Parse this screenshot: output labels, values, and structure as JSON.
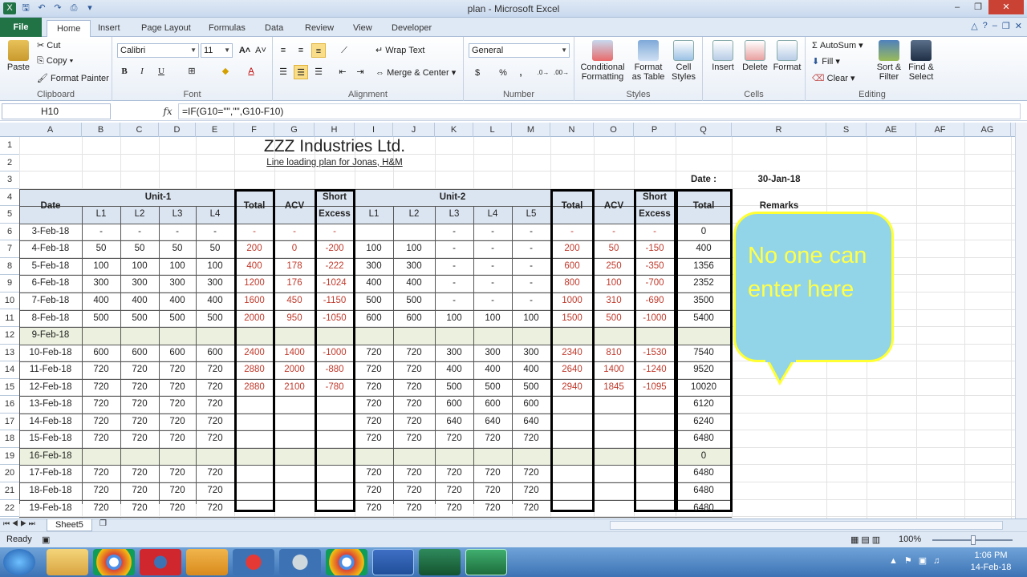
{
  "window": {
    "title": "plan  -  Microsoft Excel"
  },
  "tabs": [
    "File",
    "Home",
    "Insert",
    "Page Layout",
    "Formulas",
    "Data",
    "Review",
    "View",
    "Developer"
  ],
  "ribbon": {
    "clipboard": {
      "paste": "Paste",
      "cut": "Cut",
      "copy": "Copy",
      "format_painter": "Format Painter",
      "label": "Clipboard"
    },
    "font": {
      "name": "Calibri",
      "size": "11",
      "bold": "B",
      "italic": "I",
      "underline": "U",
      "label": "Font"
    },
    "alignment": {
      "wrap": "Wrap Text",
      "merge": "Merge & Center",
      "label": "Alignment"
    },
    "number": {
      "format": "General",
      "currency": "$",
      "percent": "%",
      "comma": ",",
      "label": "Number"
    },
    "styles": {
      "conditional": "Conditional Formatting",
      "format_table": "Format as Table",
      "cell_styles": "Cell Styles",
      "label": "Styles"
    },
    "cells": {
      "insert": "Insert",
      "delete": "Delete",
      "format": "Format",
      "label": "Cells"
    },
    "editing": {
      "autosum": "AutoSum",
      "fill": "Fill",
      "clear": "Clear",
      "sort": "Sort & Filter",
      "find": "Find & Select",
      "label": "Editing"
    }
  },
  "formula_bar": {
    "name_box": "H10",
    "fx": "fx",
    "formula": "=IF(G10=\"\",\"\",G10-F10)"
  },
  "columns": [
    "A",
    "B",
    "C",
    "D",
    "E",
    "F",
    "G",
    "H",
    "I",
    "J",
    "K",
    "L",
    "M",
    "N",
    "O",
    "P",
    "Q",
    "R",
    "S",
    "AE",
    "AF",
    "AG"
  ],
  "sheet": {
    "title": "ZZZ Industries Ltd.",
    "subtitle": "Line loading plan for Jonas, H&M",
    "date_label": "Date :",
    "date_value": "30-Jan-18",
    "headers": {
      "date": "Date",
      "unit1": "Unit-1",
      "unit2": "Unit-2",
      "total": "Total",
      "acv": "ACV",
      "short_excess_1": "Short",
      "short_excess_2": "Excess",
      "l1": "L1",
      "l2": "L2",
      "l3": "L3",
      "l4": "L4",
      "l5": "L5",
      "remarks": "Remarks"
    },
    "rows": [
      {
        "r": "6",
        "d": "3-Feb-18",
        "u1": [
          "-",
          "-",
          "-",
          "-"
        ],
        "t1": "-",
        "a1": "-",
        "s1": "-",
        "u2": [
          "",
          "",
          "-",
          "-",
          "-"
        ],
        "t2": "-",
        "a2": "-",
        "s2": "-",
        "tot": "0"
      },
      {
        "r": "7",
        "d": "4-Feb-18",
        "u1": [
          "50",
          "50",
          "50",
          "50"
        ],
        "t1": "200",
        "a1": "0",
        "s1": "-200",
        "u2": [
          "100",
          "100",
          "-",
          "-",
          "-"
        ],
        "t2": "200",
        "a2": "50",
        "s2": "-150",
        "tot": "400"
      },
      {
        "r": "8",
        "d": "5-Feb-18",
        "u1": [
          "100",
          "100",
          "100",
          "100"
        ],
        "t1": "400",
        "a1": "178",
        "s1": "-222",
        "u2": [
          "300",
          "300",
          "-",
          "-",
          "-"
        ],
        "t2": "600",
        "a2": "250",
        "s2": "-350",
        "tot": "1356"
      },
      {
        "r": "9",
        "d": "6-Feb-18",
        "u1": [
          "300",
          "300",
          "300",
          "300"
        ],
        "t1": "1200",
        "a1": "176",
        "s1": "-1024",
        "u2": [
          "400",
          "400",
          "-",
          "-",
          "-"
        ],
        "t2": "800",
        "a2": "100",
        "s2": "-700",
        "tot": "2352"
      },
      {
        "r": "10",
        "d": "7-Feb-18",
        "u1": [
          "400",
          "400",
          "400",
          "400"
        ],
        "t1": "1600",
        "a1": "450",
        "s1": "-1150",
        "u2": [
          "500",
          "500",
          "-",
          "-",
          "-"
        ],
        "t2": "1000",
        "a2": "310",
        "s2": "-690",
        "tot": "3500"
      },
      {
        "r": "11",
        "d": "8-Feb-18",
        "u1": [
          "500",
          "500",
          "500",
          "500"
        ],
        "t1": "2000",
        "a1": "950",
        "s1": "-1050",
        "u2": [
          "600",
          "600",
          "100",
          "100",
          "100"
        ],
        "t2": "1500",
        "a2": "500",
        "s2": "-1000",
        "tot": "5400"
      },
      {
        "r": "12",
        "d": "9-Feb-18",
        "u1": [
          "",
          "",
          "",
          ""
        ],
        "t1": "",
        "a1": "",
        "s1": "",
        "u2": [
          "",
          "",
          "",
          "",
          ""
        ],
        "t2": "",
        "a2": "",
        "s2": "",
        "tot": "",
        "shade": true
      },
      {
        "r": "13",
        "d": "10-Feb-18",
        "u1": [
          "600",
          "600",
          "600",
          "600"
        ],
        "t1": "2400",
        "a1": "1400",
        "s1": "-1000",
        "u2": [
          "720",
          "720",
          "300",
          "300",
          "300"
        ],
        "t2": "2340",
        "a2": "810",
        "s2": "-1530",
        "tot": "7540"
      },
      {
        "r": "14",
        "d": "11-Feb-18",
        "u1": [
          "720",
          "720",
          "720",
          "720"
        ],
        "t1": "2880",
        "a1": "2000",
        "s1": "-880",
        "u2": [
          "720",
          "720",
          "400",
          "400",
          "400"
        ],
        "t2": "2640",
        "a2": "1400",
        "s2": "-1240",
        "tot": "9520"
      },
      {
        "r": "15",
        "d": "12-Feb-18",
        "u1": [
          "720",
          "720",
          "720",
          "720"
        ],
        "t1": "2880",
        "a1": "2100",
        "s1": "-780",
        "u2": [
          "720",
          "720",
          "500",
          "500",
          "500"
        ],
        "t2": "2940",
        "a2": "1845",
        "s2": "-1095",
        "tot": "10020"
      },
      {
        "r": "16",
        "d": "13-Feb-18",
        "u1": [
          "720",
          "720",
          "720",
          "720"
        ],
        "t1": "",
        "a1": "",
        "s1": "",
        "u2": [
          "720",
          "720",
          "600",
          "600",
          "600"
        ],
        "t2": "",
        "a2": "",
        "s2": "",
        "tot": "6120"
      },
      {
        "r": "17",
        "d": "14-Feb-18",
        "u1": [
          "720",
          "720",
          "720",
          "720"
        ],
        "t1": "",
        "a1": "",
        "s1": "",
        "u2": [
          "720",
          "720",
          "640",
          "640",
          "640"
        ],
        "t2": "",
        "a2": "",
        "s2": "",
        "tot": "6240"
      },
      {
        "r": "18",
        "d": "15-Feb-18",
        "u1": [
          "720",
          "720",
          "720",
          "720"
        ],
        "t1": "",
        "a1": "",
        "s1": "",
        "u2": [
          "720",
          "720",
          "720",
          "720",
          "720"
        ],
        "t2": "",
        "a2": "",
        "s2": "",
        "tot": "6480"
      },
      {
        "r": "19",
        "d": "16-Feb-18",
        "u1": [
          "",
          "",
          "",
          ""
        ],
        "t1": "",
        "a1": "",
        "s1": "",
        "u2": [
          "",
          "",
          "",
          "",
          ""
        ],
        "t2": "",
        "a2": "",
        "s2": "",
        "tot": "0",
        "shade": true
      },
      {
        "r": "20",
        "d": "17-Feb-18",
        "u1": [
          "720",
          "720",
          "720",
          "720"
        ],
        "t1": "",
        "a1": "",
        "s1": "",
        "u2": [
          "720",
          "720",
          "720",
          "720",
          "720"
        ],
        "t2": "",
        "a2": "",
        "s2": "",
        "tot": "6480"
      },
      {
        "r": "21",
        "d": "18-Feb-18",
        "u1": [
          "720",
          "720",
          "720",
          "720"
        ],
        "t1": "",
        "a1": "",
        "s1": "",
        "u2": [
          "720",
          "720",
          "720",
          "720",
          "720"
        ],
        "t2": "",
        "a2": "",
        "s2": "",
        "tot": "6480"
      },
      {
        "r": "22",
        "d": "19-Feb-18",
        "u1": [
          "720",
          "720",
          "720",
          "720"
        ],
        "t1": "",
        "a1": "",
        "s1": "",
        "u2": [
          "720",
          "720",
          "720",
          "720",
          "720"
        ],
        "t2": "",
        "a2": "",
        "s2": "",
        "tot": "6480"
      }
    ]
  },
  "callout": {
    "text": "No one can enter here"
  },
  "sheet_tab": "Sheet5",
  "status": {
    "ready": "Ready",
    "zoom": "100%"
  },
  "taskbar": {
    "time": "1:06 PM",
    "date": "14-Feb-18"
  },
  "colors": {
    "excel_green": "#217346",
    "red_value": "#c0392b",
    "shade": "#ebf1de",
    "callout_fill": "#92d5e8",
    "callout_border": "#ffff33"
  }
}
